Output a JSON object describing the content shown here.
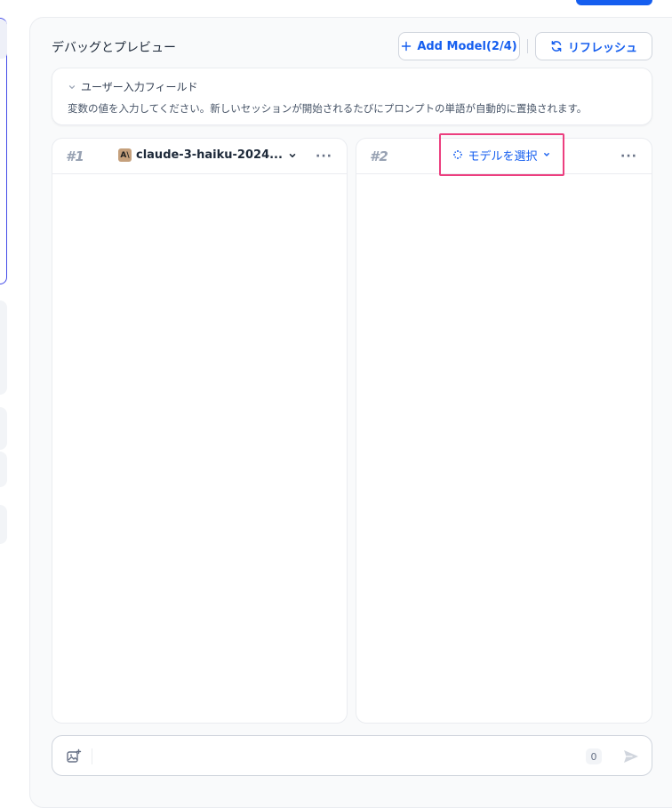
{
  "panel": {
    "title": "デバッグとプレビュー",
    "add_model_label": "Add Model(2/4)",
    "refresh_label": "リフレッシュ"
  },
  "user_input_field": {
    "heading": "ユーザー入力フィールド",
    "description": "変数の値を入力してください。新しいセッションが開始されるたびにプロンプトの単語が自動的に置換されます。"
  },
  "columns": [
    {
      "number": "#1",
      "model_name": "claude-3-haiku-2024...",
      "more": "···"
    },
    {
      "number": "#2",
      "select_label": "モデルを選択",
      "more": "···"
    }
  ],
  "chat": {
    "char_count": "0"
  },
  "colors": {
    "accent": "#155eef",
    "highlight": "#ec3f7f",
    "sidebar_active": "#444ce7"
  },
  "icons": [
    "plus-icon",
    "refresh-icon",
    "chevron-down-icon",
    "anthropic-icon",
    "more-icon",
    "model-spinner-icon",
    "image-upload-icon",
    "send-icon"
  ]
}
